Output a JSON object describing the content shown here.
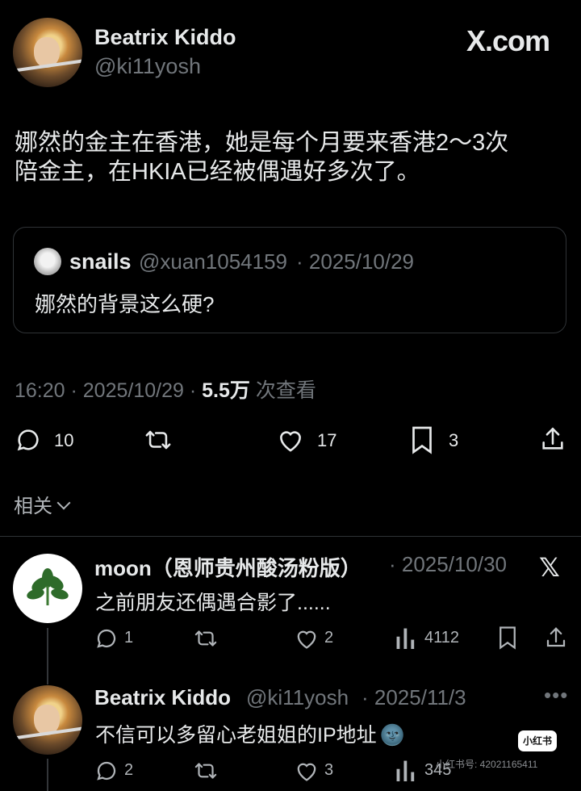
{
  "brand": "X.com",
  "post": {
    "author_name": "Beatrix Kiddo",
    "author_handle": "@ki11yosh",
    "text_line1": "娜然的金主在香港，她是每个月要来香港2～3次",
    "text_line2": "陪金主，在HKIA已经被偶遇好多次了。",
    "time": "16:20 · 2025/10/29 · ",
    "views_count": "5.5万",
    "views_label": " 次查看",
    "replies": "10",
    "likes": "17",
    "bookmarks": "3"
  },
  "quote": {
    "author_name": "snails",
    "author_handle": "@xuan1054159",
    "date": "· 2025/10/29",
    "text": "娜然的背景这么硬?"
  },
  "related_label": "相关",
  "replies": [
    {
      "author_name": "moon（恩师贵州酸汤粉版）",
      "date": "· 2025/10/30",
      "text": "之前朋友还偶遇合影了......",
      "replies": "1",
      "likes": "2",
      "views": "4112"
    },
    {
      "author_name": "Beatrix Kiddo",
      "author_handle": "@ki11yosh",
      "date": "· 2025/11/3",
      "text": "不信可以多留心老姐姐的IP地址",
      "emoji": "🌚",
      "replies": "2",
      "likes": "3",
      "views": "345"
    }
  ],
  "watermark": {
    "logo": "小红书",
    "text": "小红书号: 42021165411"
  },
  "colors": {
    "background": "#000000",
    "text": "#e7e9ea",
    "muted": "#71767b",
    "border": "#2f3336"
  }
}
